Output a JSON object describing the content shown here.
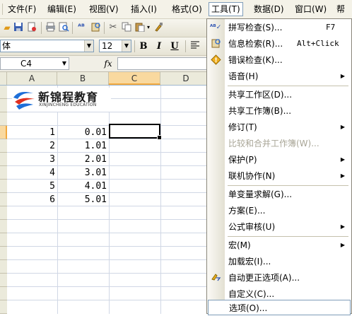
{
  "menubar": {
    "items": [
      {
        "label": "文件(F)"
      },
      {
        "label": "编辑(E)"
      },
      {
        "label": "视图(V)"
      },
      {
        "label": "插入(I)"
      },
      {
        "label": "格式(O)"
      },
      {
        "label": "工具(T)"
      },
      {
        "label": "数据(D)"
      },
      {
        "label": "窗口(W)"
      },
      {
        "label": "帮"
      }
    ]
  },
  "toolbar": {
    "font_name": "体",
    "font_size": "12",
    "bold": "B",
    "italic": "I",
    "underline": "U"
  },
  "formula_bar": {
    "name_box": "C4",
    "fx": "fx",
    "formula": ""
  },
  "grid": {
    "columns": [
      "A",
      "B",
      "C",
      "D"
    ],
    "selected_column": "C",
    "active_cell": "C4",
    "rows": [
      {
        "a": "1",
        "b": "0.01"
      },
      {
        "a": "2",
        "b": "1.01"
      },
      {
        "a": "3",
        "b": "2.01"
      },
      {
        "a": "4",
        "b": "3.01"
      },
      {
        "a": "5",
        "b": "4.01"
      },
      {
        "a": "6",
        "b": "5.01"
      }
    ]
  },
  "logo": {
    "title": "新锦程教育",
    "subtitle": "XINJINCHENG EDUCATION"
  },
  "tools_menu": {
    "items": [
      {
        "label": "拼写检查(S)...",
        "shortcut": "F7",
        "icon": "spell-check-icon"
      },
      {
        "label": "信息检索(R)...",
        "shortcut": "Alt+Click",
        "icon": "research-icon"
      },
      {
        "label": "错误检查(K)...",
        "icon": "error-check-icon"
      },
      {
        "label": "语音(H)",
        "submenu": true
      },
      {
        "label": "共享工作区(D)..."
      },
      {
        "label": "共享工作簿(B)..."
      },
      {
        "label": "修订(T)",
        "submenu": true
      },
      {
        "label": "比较和合并工作簿(W)...",
        "disabled": true
      },
      {
        "label": "保护(P)",
        "submenu": true
      },
      {
        "label": "联机协作(N)",
        "submenu": true
      },
      {
        "label": "单变量求解(G)..."
      },
      {
        "label": "方案(E)..."
      },
      {
        "label": "公式审核(U)",
        "submenu": true
      },
      {
        "label": "宏(M)",
        "submenu": true
      },
      {
        "label": "加载宏(I)..."
      },
      {
        "label": "自动更正选项(A)...",
        "icon": "autocorrect-icon"
      },
      {
        "label": "自定义(C)..."
      },
      {
        "label": "选项(O)...",
        "highlighted": true
      }
    ]
  },
  "colors": {
    "menu_bar_bg": "#f4f2e8",
    "selected_header": "#f9d99f",
    "selected_header_border": "#f2a93e",
    "highlight_border": "#7f9db9",
    "logo_blue": "#1e6fd8",
    "logo_red": "#e03020"
  }
}
